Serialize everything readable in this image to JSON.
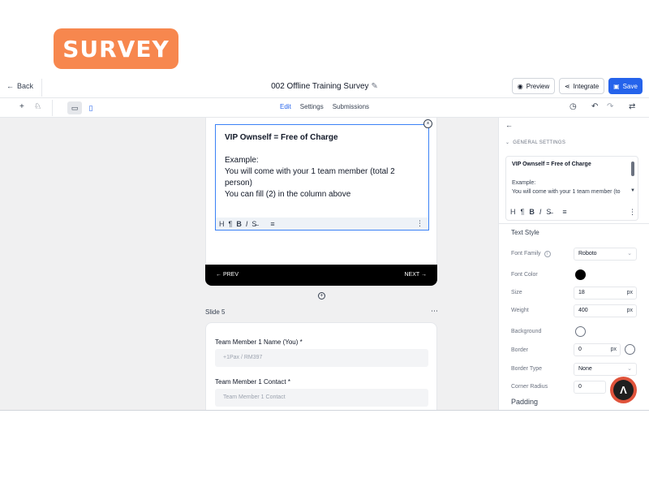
{
  "logo": {
    "text": "SURVEY",
    "color": "#f7874e"
  },
  "topbar": {
    "back_label": "Back",
    "title": "002 Offline Training Survey",
    "preview_label": "Preview",
    "integrate_label": "Integrate",
    "save_label": "Save",
    "accent": "#2563eb"
  },
  "subbar": {
    "tabs": [
      {
        "label": "Edit",
        "active": true
      },
      {
        "label": "Settings",
        "active": false
      },
      {
        "label": "Submissions",
        "active": false
      }
    ]
  },
  "canvas": {
    "editor": {
      "heading": "VIP Ownself = Free of Charge",
      "lines": [
        "Example:",
        "You will come with your 1 team member (total 2",
        "person)",
        "You can fill (2) in the column above"
      ]
    },
    "nav": {
      "prev_label": "← PREV",
      "next_label": "NEXT →"
    },
    "slide5": {
      "label": "Slide 5",
      "questions": [
        {
          "label": "Team Member 1 Name (You) *",
          "placeholder": "+1Pax / RM397"
        },
        {
          "label": "Team Member 1 Contact *",
          "placeholder": "Team Member 1 Contact"
        }
      ]
    }
  },
  "panel": {
    "section_title": "GENERAL SETTINGS",
    "preview": {
      "heading": "VIP Ownself = Free of Charge",
      "line1": "Example:",
      "line2": "You will come with your 1 team member (to"
    },
    "text_style_label": "Text Style",
    "props": {
      "font_family": {
        "label": "Font Family",
        "value": "Roboto"
      },
      "font_color": {
        "label": "Font Color",
        "value": "#000000"
      },
      "size": {
        "label": "Size",
        "value": "18",
        "unit": "px"
      },
      "weight": {
        "label": "Weight",
        "value": "400",
        "unit": "px"
      },
      "background": {
        "label": "Background"
      },
      "border": {
        "label": "Border",
        "value": "0",
        "unit": "px"
      },
      "border_type": {
        "label": "Border Type",
        "value": "None"
      },
      "corner_radius": {
        "label": "Corner Radius",
        "value": "0"
      }
    },
    "padding_label": "Padding"
  }
}
